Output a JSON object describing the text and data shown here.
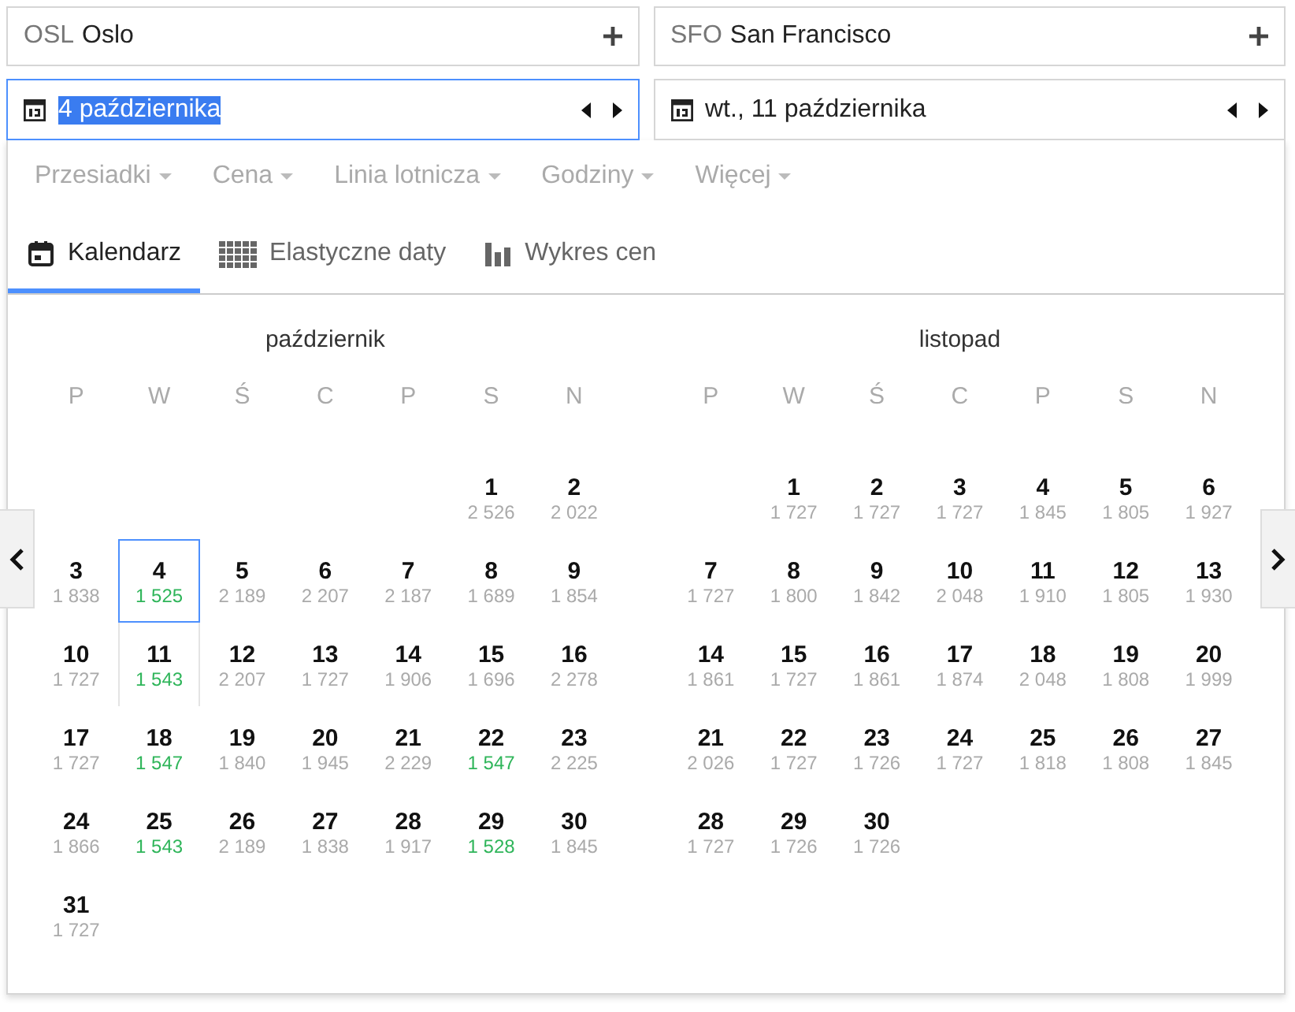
{
  "route": [
    {
      "code": "OSL",
      "city": "Oslo"
    },
    {
      "code": "SFO",
      "city": "San Francisco"
    }
  ],
  "dates": [
    {
      "value": "4 października",
      "focused": true
    },
    {
      "value": "wt., 11 października",
      "focused": false
    }
  ],
  "filters": [
    "Przesiadki",
    "Cena",
    "Linia lotnicza",
    "Godziny",
    "Więcej"
  ],
  "tabs": [
    {
      "label": "Kalendarz",
      "selected": true
    },
    {
      "label": "Elastyczne daty",
      "selected": false
    },
    {
      "label": "Wykres cen",
      "selected": false
    }
  ],
  "months": [
    {
      "title": "październik",
      "weekdays": [
        "P",
        "W",
        "Ś",
        "C",
        "P",
        "S",
        "N"
      ],
      "weeks": [
        {
          "days": [
            {
              "day": "1",
              "price": "2 526",
              "cheap": false,
              "selected": false,
              "in_range": false
            },
            {
              "day": "2",
              "price": "2 022",
              "cheap": false,
              "selected": false,
              "in_range": false
            }
          ]
        },
        {
          "days": [
            {
              "day": "3",
              "price": "1 838",
              "cheap": false,
              "selected": false,
              "in_range": false
            },
            {
              "day": "4",
              "price": "1 525",
              "cheap": true,
              "selected": true,
              "in_range": false
            },
            {
              "day": "5",
              "price": "2 189",
              "cheap": false,
              "selected": false,
              "in_range": false
            },
            {
              "day": "6",
              "price": "2 207",
              "cheap": false,
              "selected": false,
              "in_range": false
            },
            {
              "day": "7",
              "price": "2 187",
              "cheap": false,
              "selected": false,
              "in_range": false
            },
            {
              "day": "8",
              "price": "1 689",
              "cheap": false,
              "selected": false,
              "in_range": false
            },
            {
              "day": "9",
              "price": "1 854",
              "cheap": false,
              "selected": false,
              "in_range": false
            }
          ]
        },
        {
          "days": [
            {
              "day": "10",
              "price": "1 727",
              "cheap": false,
              "selected": false,
              "in_range": false
            },
            {
              "day": "11",
              "price": "1 543",
              "cheap": true,
              "selected": false,
              "in_range": true
            },
            {
              "day": "12",
              "price": "2 207",
              "cheap": false,
              "selected": false,
              "in_range": false
            },
            {
              "day": "13",
              "price": "1 727",
              "cheap": false,
              "selected": false,
              "in_range": false
            },
            {
              "day": "14",
              "price": "1 906",
              "cheap": false,
              "selected": false,
              "in_range": false
            },
            {
              "day": "15",
              "price": "1 696",
              "cheap": false,
              "selected": false,
              "in_range": false
            },
            {
              "day": "16",
              "price": "2 278",
              "cheap": false,
              "selected": false,
              "in_range": false
            }
          ]
        },
        {
          "days": [
            {
              "day": "17",
              "price": "1 727",
              "cheap": false,
              "selected": false,
              "in_range": false
            },
            {
              "day": "18",
              "price": "1 547",
              "cheap": true,
              "selected": false,
              "in_range": false
            },
            {
              "day": "19",
              "price": "1 840",
              "cheap": false,
              "selected": false,
              "in_range": false
            },
            {
              "day": "20",
              "price": "1 945",
              "cheap": false,
              "selected": false,
              "in_range": false
            },
            {
              "day": "21",
              "price": "2 229",
              "cheap": false,
              "selected": false,
              "in_range": false
            },
            {
              "day": "22",
              "price": "1 547",
              "cheap": true,
              "selected": false,
              "in_range": false
            },
            {
              "day": "23",
              "price": "2 225",
              "cheap": false,
              "selected": false,
              "in_range": false
            }
          ]
        },
        {
          "days": [
            {
              "day": "24",
              "price": "1 866",
              "cheap": false,
              "selected": false,
              "in_range": false
            },
            {
              "day": "25",
              "price": "1 543",
              "cheap": true,
              "selected": false,
              "in_range": false
            },
            {
              "day": "26",
              "price": "2 189",
              "cheap": false,
              "selected": false,
              "in_range": false
            },
            {
              "day": "27",
              "price": "1 838",
              "cheap": false,
              "selected": false,
              "in_range": false
            },
            {
              "day": "28",
              "price": "1 917",
              "cheap": false,
              "selected": false,
              "in_range": false
            },
            {
              "day": "29",
              "price": "1 528",
              "cheap": true,
              "selected": false,
              "in_range": false
            },
            {
              "day": "30",
              "price": "1 845",
              "cheap": false,
              "selected": false,
              "in_range": false
            }
          ]
        },
        {
          "days": [
            {
              "day": "31",
              "price": "1 727",
              "cheap": false,
              "selected": false,
              "in_range": false
            }
          ]
        }
      ]
    },
    {
      "title": "listopad",
      "weekdays": [
        "P",
        "W",
        "Ś",
        "C",
        "P",
        "S",
        "N"
      ],
      "weeks": [
        {
          "days": [
            {
              "day": "1",
              "price": "1 727",
              "cheap": false,
              "selected": false,
              "in_range": false
            },
            {
              "day": "2",
              "price": "1 727",
              "cheap": false,
              "selected": false,
              "in_range": false
            },
            {
              "day": "3",
              "price": "1 727",
              "cheap": false,
              "selected": false,
              "in_range": false
            },
            {
              "day": "4",
              "price": "1 845",
              "cheap": false,
              "selected": false,
              "in_range": false
            },
            {
              "day": "5",
              "price": "1 805",
              "cheap": false,
              "selected": false,
              "in_range": false
            },
            {
              "day": "6",
              "price": "1 927",
              "cheap": false,
              "selected": false,
              "in_range": false
            }
          ]
        },
        {
          "days": [
            {
              "day": "7",
              "price": "1 727",
              "cheap": false,
              "selected": false,
              "in_range": false
            },
            {
              "day": "8",
              "price": "1 800",
              "cheap": false,
              "selected": false,
              "in_range": false
            },
            {
              "day": "9",
              "price": "1 842",
              "cheap": false,
              "selected": false,
              "in_range": false
            },
            {
              "day": "10",
              "price": "2 048",
              "cheap": false,
              "selected": false,
              "in_range": false
            },
            {
              "day": "11",
              "price": "1 910",
              "cheap": false,
              "selected": false,
              "in_range": false
            },
            {
              "day": "12",
              "price": "1 805",
              "cheap": false,
              "selected": false,
              "in_range": false
            },
            {
              "day": "13",
              "price": "1 930",
              "cheap": false,
              "selected": false,
              "in_range": false
            }
          ]
        },
        {
          "days": [
            {
              "day": "14",
              "price": "1 861",
              "cheap": false,
              "selected": false,
              "in_range": false
            },
            {
              "day": "15",
              "price": "1 727",
              "cheap": false,
              "selected": false,
              "in_range": false
            },
            {
              "day": "16",
              "price": "1 861",
              "cheap": false,
              "selected": false,
              "in_range": false
            },
            {
              "day": "17",
              "price": "1 874",
              "cheap": false,
              "selected": false,
              "in_range": false
            },
            {
              "day": "18",
              "price": "2 048",
              "cheap": false,
              "selected": false,
              "in_range": false
            },
            {
              "day": "19",
              "price": "1 808",
              "cheap": false,
              "selected": false,
              "in_range": false
            },
            {
              "day": "20",
              "price": "1 999",
              "cheap": false,
              "selected": false,
              "in_range": false
            }
          ]
        },
        {
          "days": [
            {
              "day": "21",
              "price": "2 026",
              "cheap": false,
              "selected": false,
              "in_range": false
            },
            {
              "day": "22",
              "price": "1 727",
              "cheap": false,
              "selected": false,
              "in_range": false
            },
            {
              "day": "23",
              "price": "1 726",
              "cheap": false,
              "selected": false,
              "in_range": false
            },
            {
              "day": "24",
              "price": "1 727",
              "cheap": false,
              "selected": false,
              "in_range": false
            },
            {
              "day": "25",
              "price": "1 818",
              "cheap": false,
              "selected": false,
              "in_range": false
            },
            {
              "day": "26",
              "price": "1 808",
              "cheap": false,
              "selected": false,
              "in_range": false
            },
            {
              "day": "27",
              "price": "1 845",
              "cheap": false,
              "selected": false,
              "in_range": false
            }
          ]
        },
        {
          "days": [
            {
              "day": "28",
              "price": "1 727",
              "cheap": false,
              "selected": false,
              "in_range": false
            },
            {
              "day": "29",
              "price": "1 726",
              "cheap": false,
              "selected": false,
              "in_range": false
            },
            {
              "day": "30",
              "price": "1 726",
              "cheap": false,
              "selected": false,
              "in_range": false
            }
          ]
        }
      ]
    }
  ]
}
